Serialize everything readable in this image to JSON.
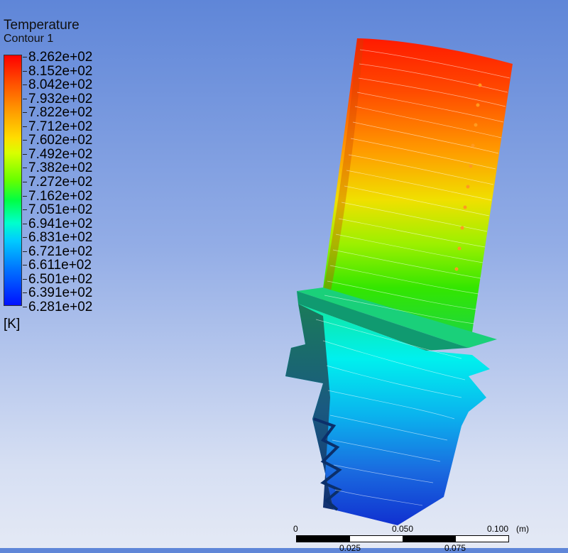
{
  "legend": {
    "title": "Temperature",
    "subtitle": "Contour 1",
    "unit": "[K]",
    "levels": [
      "8.262e+02",
      "8.152e+02",
      "8.042e+02",
      "7.932e+02",
      "7.822e+02",
      "7.712e+02",
      "7.602e+02",
      "7.492e+02",
      "7.382e+02",
      "7.272e+02",
      "7.162e+02",
      "7.051e+02",
      "6.941e+02",
      "6.831e+02",
      "6.721e+02",
      "6.611e+02",
      "6.501e+02",
      "6.391e+02",
      "6.281e+02"
    ],
    "colors": {
      "max": "#ff0000",
      "high": "#ff9900",
      "mid_high": "#ffdd00",
      "mid": "#66ff00",
      "mid_low": "#00ffcc",
      "low": "#0077ff",
      "min": "#0011ff"
    }
  },
  "scale_bar": {
    "top_labels": [
      "0",
      "0.050",
      "0.100"
    ],
    "bottom_labels": [
      "0.025",
      "0.075"
    ],
    "unit": "(m)"
  }
}
